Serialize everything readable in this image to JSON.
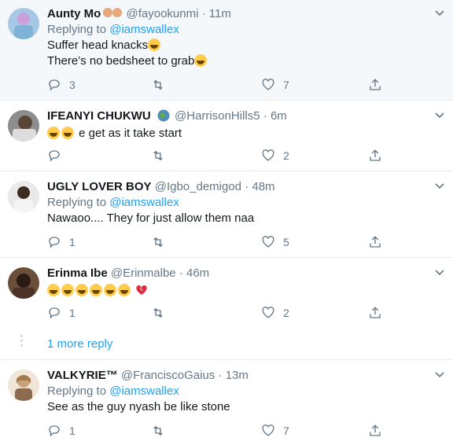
{
  "colors": {
    "link": "#1da1f2",
    "muted": "#657786",
    "divider": "#e6ecf0",
    "highlight_bg": "#f5f8fa"
  },
  "tweets": [
    {
      "name": "Aunty Mo",
      "handle": "@fayookunmi",
      "time": "11m",
      "replying_prefix": "Replying to",
      "replying_to": "@iamswallex",
      "lines": [
        "Suffer head knacks",
        "There’s no bedsheet to grab"
      ],
      "replies": "3",
      "retweets": "",
      "likes": "7"
    },
    {
      "name": "IFEANYI CHUKWU",
      "handle": "@HarrisonHills5",
      "time": "6m",
      "lines": [
        "e get as it take start"
      ],
      "replies": "",
      "retweets": "",
      "likes": "2"
    },
    {
      "name": "UGLY LOVER BOY",
      "handle": "@Igbo_demigod",
      "time": "48m",
      "replying_prefix": "Replying to",
      "replying_to": "@iamswallex",
      "lines": [
        "Nawaoo.... They for just allow them naa"
      ],
      "replies": "1",
      "retweets": "",
      "likes": "5"
    },
    {
      "name": "Erinma Ibe",
      "handle": "@Erinmalbe",
      "time": "46m",
      "lines": [],
      "replies": "1",
      "retweets": "",
      "likes": "2"
    },
    {
      "name": "VALKYRIE™",
      "handle": "@FranciscoGaius",
      "time": "13m",
      "replying_prefix": "Replying to",
      "replying_to": "@iamswallex",
      "lines": [
        "See as the guy nyash be like stone"
      ],
      "replies": "1",
      "retweets": "",
      "likes": "7"
    }
  ],
  "more_reply_label": "1 more reply",
  "separator": "·",
  "icons": [
    "reply-icon",
    "retweet-icon",
    "like-icon",
    "share-icon",
    "chevron-down-icon",
    "verified-globe-icon"
  ]
}
